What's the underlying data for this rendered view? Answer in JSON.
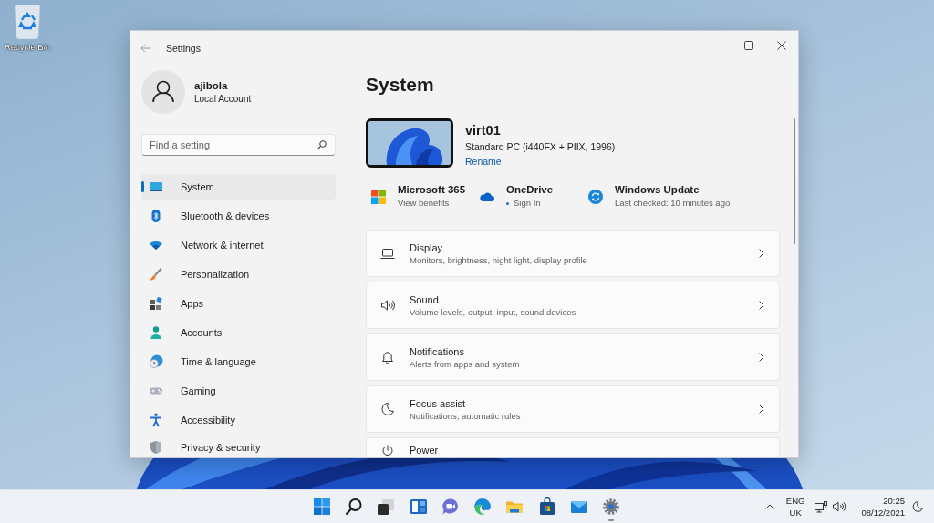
{
  "desktop": {
    "shortcuts": [
      {
        "label": "Recycle Bin"
      }
    ]
  },
  "window": {
    "title": "Settings"
  },
  "sidebar": {
    "account": {
      "name": "ajibola",
      "type": "Local Account"
    },
    "search": {
      "placeholder": "Find a setting"
    },
    "items": [
      {
        "label": "System",
        "selected": true
      },
      {
        "label": "Bluetooth & devices",
        "selected": false
      },
      {
        "label": "Network & internet",
        "selected": false
      },
      {
        "label": "Personalization",
        "selected": false
      },
      {
        "label": "Apps",
        "selected": false
      },
      {
        "label": "Accounts",
        "selected": false
      },
      {
        "label": "Time & language",
        "selected": false
      },
      {
        "label": "Gaming",
        "selected": false
      },
      {
        "label": "Accessibility",
        "selected": false
      },
      {
        "label": "Privacy & security",
        "selected": false
      }
    ]
  },
  "main": {
    "heading": "System",
    "device": {
      "name": "virt01",
      "model": "Standard PC (i440FX + PIIX, 1996)",
      "link": "Rename"
    },
    "quick_links": [
      {
        "title": "Microsoft 365",
        "subtitle": "View benefits",
        "status_dot": false
      },
      {
        "title": "OneDrive",
        "subtitle": "Sign In",
        "status_dot": true
      },
      {
        "title": "Windows Update",
        "subtitle": "Last checked: 10 minutes ago",
        "status_dot": false
      }
    ],
    "settings": [
      {
        "title": "Display",
        "description": "Monitors, brightness, night light, display profile"
      },
      {
        "title": "Sound",
        "description": "Volume levels, output, input, sound devices"
      },
      {
        "title": "Notifications",
        "description": "Alerts from apps and system"
      },
      {
        "title": "Focus assist",
        "description": "Notifications, automatic rules"
      },
      {
        "title": "Power"
      }
    ]
  },
  "taskbar": {
    "apps": [
      {
        "running": false
      },
      {
        "running": false
      },
      {
        "running": false
      },
      {
        "running": false
      },
      {
        "running": false
      },
      {
        "running": false
      },
      {
        "running": false
      },
      {
        "running": false
      },
      {
        "running": false
      },
      {
        "running": true
      }
    ],
    "language": {
      "line_1": "ENG",
      "line_2": "UK"
    },
    "clock": {
      "time": "20:25",
      "date": "08/12/2021"
    }
  }
}
